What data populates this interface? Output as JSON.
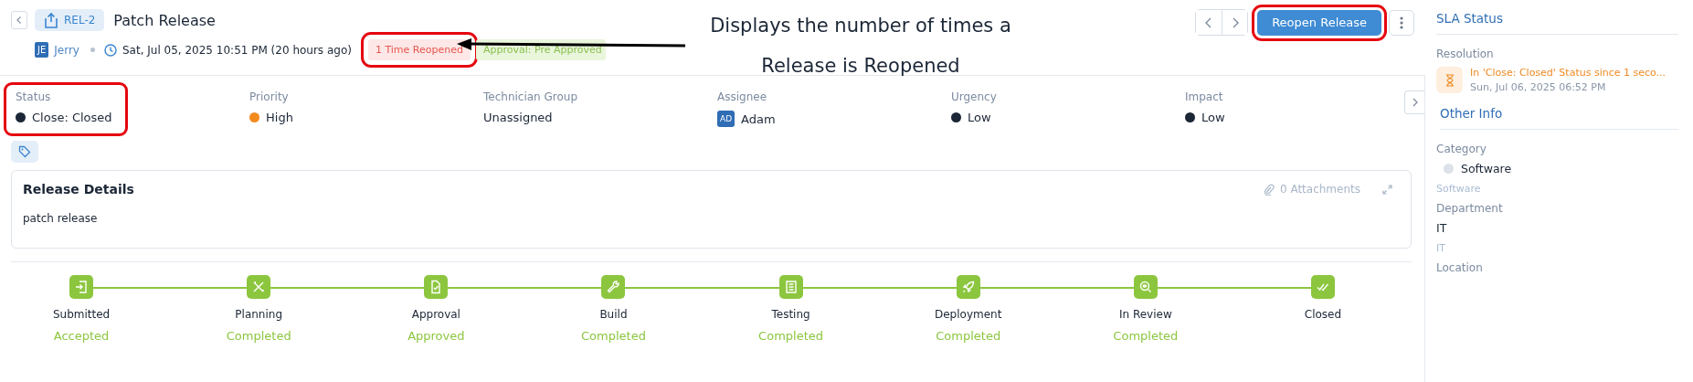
{
  "header": {
    "id": "REL-2",
    "title": "Patch Release",
    "author_initials": "JE",
    "author": "Jerry",
    "created": "Sat, Jul 05, 2025 10:51 PM (20 hours ago)",
    "badges": [
      {
        "kind": "reopened",
        "text": "1 Time Reopened",
        "highlighted": true
      },
      {
        "kind": "approval",
        "text": "Approval: Pre Approved",
        "highlighted": false
      }
    ],
    "primary_action": {
      "label": "Reopen Release",
      "highlighted": true
    }
  },
  "annotation": {
    "text": "Displays the number of times a Release is Reopened"
  },
  "fields": [
    {
      "label": "Status",
      "value": "Close: Closed",
      "kind": "dot",
      "color": "#1b2636",
      "highlighted": true
    },
    {
      "label": "Priority",
      "value": "High",
      "kind": "dot",
      "color": "#f28a1e",
      "highlighted": false
    },
    {
      "label": "Technician Group",
      "value": "Unassigned",
      "kind": "text",
      "highlighted": false
    },
    {
      "label": "Assignee",
      "value": "Adam",
      "kind": "avatar",
      "initials": "AD",
      "highlighted": false
    },
    {
      "label": "Urgency",
      "value": "Low",
      "kind": "dot",
      "color": "#1b2636",
      "highlighted": false
    },
    {
      "label": "Impact",
      "value": "Low",
      "kind": "dot",
      "color": "#1b2636",
      "highlighted": false
    }
  ],
  "details": {
    "title": "Release Details",
    "attachments": "0 Attachments",
    "description": "patch release"
  },
  "stages": [
    {
      "name": "Submitted",
      "status": "Accepted"
    },
    {
      "name": "Planning",
      "status": "Completed"
    },
    {
      "name": "Approval",
      "status": "Approved"
    },
    {
      "name": "Build",
      "status": "Completed"
    },
    {
      "name": "Testing",
      "status": "Completed"
    },
    {
      "name": "Deployment",
      "status": "Completed"
    },
    {
      "name": "In Review",
      "status": "Completed"
    },
    {
      "name": "Closed"
    }
  ],
  "sidebar": {
    "sla": {
      "title": "SLA Status",
      "label": "Resolution",
      "message": "In 'Close: Closed' Status since 1 seco...",
      "time": "Sun, Jul 06, 2025 06:52 PM"
    },
    "other_info": {
      "title": "Other Info",
      "fields": [
        {
          "label": "Category",
          "value": "Software",
          "kind": "dot",
          "color": "#dde1e9",
          "sub": "Software"
        },
        {
          "label": "Department",
          "value": "IT",
          "kind": "text",
          "sub": "IT"
        },
        {
          "label": "Location",
          "kind": "label"
        }
      ]
    }
  }
}
